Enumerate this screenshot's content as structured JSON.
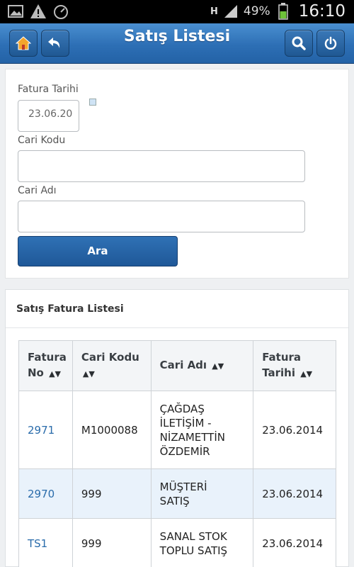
{
  "status_bar": {
    "network": "H",
    "battery": "49%",
    "time": "16:10",
    "icons": [
      "image-icon",
      "warning-icon",
      "gauge-icon",
      "signal-icon",
      "battery-icon"
    ]
  },
  "header": {
    "title": "Satış Listesi",
    "buttons": [
      "home-icon",
      "back-icon",
      "search-icon",
      "power-icon"
    ]
  },
  "search_form": {
    "date_label": "Fatura Tarihi",
    "date_value": "23.06.20",
    "cari_kodu_label": "Cari Kodu",
    "cari_kodu_value": "",
    "cari_adi_label": "Cari Adı",
    "cari_adi_value": "",
    "search_button": "Ara"
  },
  "list": {
    "title": "Satış Fatura Listesi",
    "columns": {
      "fatura_no_1": "Fatura",
      "fatura_no_2": "No",
      "cari_kodu": "Cari Kodu",
      "cari_adi": "Cari Adı",
      "fatura_tarihi_1": "Fatura",
      "fatura_tarihi_2": "Tarihi"
    },
    "rows": [
      {
        "no": "2971",
        "kod": "M1000088",
        "ad_lines": [
          "ÇAĞDAŞ",
          "İLETİŞİM -",
          "NİZAMETTİN",
          "ÖZDEMİR"
        ],
        "tarih": "23.06.2014"
      },
      {
        "no": "2970",
        "kod": "999",
        "ad_lines": [
          "MÜŞTERİ",
          "SATIŞ"
        ],
        "tarih": "23.06.2014"
      },
      {
        "no": "TS1",
        "kod": "999",
        "ad_lines": [
          "SANAL STOK",
          "TOPLU SATIŞ"
        ],
        "tarih": "23.06.2014"
      }
    ]
  },
  "colors": {
    "header_blue": "#2d6fb5",
    "link_blue": "#2a6cab",
    "alt_row": "#e9f2fb"
  }
}
